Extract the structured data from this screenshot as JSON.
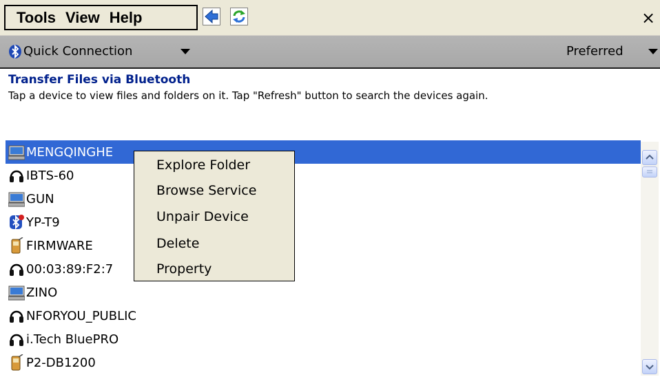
{
  "menu": {
    "tools": "Tools",
    "view": "View",
    "help": "Help",
    "back_icon": "back-arrow-icon",
    "refresh_icon": "refresh-icon",
    "close": "×"
  },
  "connection_bar": {
    "icon": "bluetooth-icon",
    "label": "Quick Connection",
    "preferred": "Preferred"
  },
  "header": {
    "title": "Transfer Files via Bluetooth",
    "description": "Tap a device to view files and folders on it. Tap \"Refresh\" button to search the devices again."
  },
  "devices": [
    {
      "name": "MENGQINGHE",
      "icon": "computer-icon",
      "selected": true
    },
    {
      "name": "IBTS-60",
      "icon": "headset-icon"
    },
    {
      "name": "GUN",
      "icon": "computer-icon"
    },
    {
      "name": "YP-T9",
      "icon": "bluetooth-device-icon"
    },
    {
      "name": "FIRMWARE",
      "icon": "phone-icon"
    },
    {
      "name": "00:03:89:F2:7",
      "icon": "headset-icon"
    },
    {
      "name": "ZINO",
      "icon": "computer-icon"
    },
    {
      "name": "NFORYOU_PUBLIC",
      "icon": "headset-icon"
    },
    {
      "name": "i.Tech BluePRO",
      "icon": "headset-icon"
    },
    {
      "name": "P2-DB1200",
      "icon": "phone-icon"
    }
  ],
  "context_menu": {
    "items": [
      "Explore Folder",
      "Browse Service",
      "Unpair Device",
      "Delete",
      "Property"
    ]
  },
  "colors": {
    "selection": "#3168d5",
    "title": "#00208c",
    "menu_bg": "#ece9d8"
  }
}
